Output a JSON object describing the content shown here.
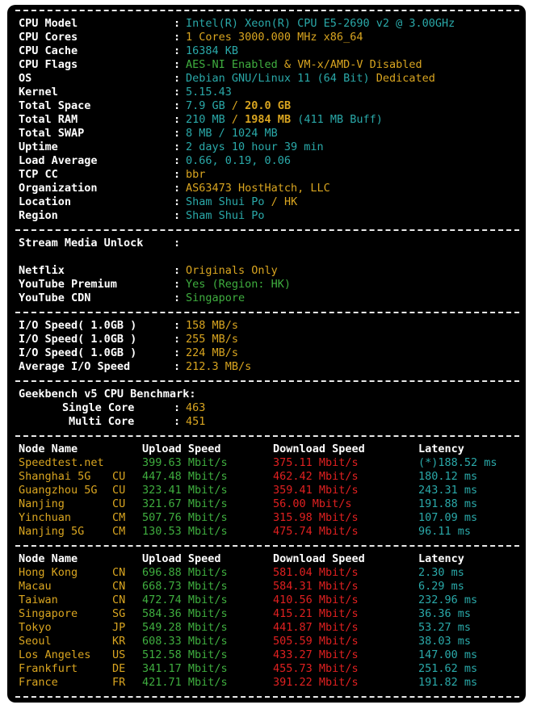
{
  "sysinfo": [
    {
      "label": "CPU Model",
      "value": "Intel(R) Xeon(R) CPU E5-2690 v2 @ 3.00GHz"
    },
    {
      "label": "CPU Cores",
      "value": "1 Cores 3000.000 MHz x86_64"
    },
    {
      "label": "CPU Cache",
      "value": "16384 KB"
    },
    {
      "label": "CPU Flags",
      "value_a": "AES-NI Enabled",
      "amp": " & ",
      "value_b": "VM-x/AMD-V Disabled"
    },
    {
      "label": "OS",
      "value_a": "Debian GNU/Linux 11 (64 Bit)",
      "value_b": " Dedicated"
    },
    {
      "label": "Kernel",
      "value": "5.15.43"
    },
    {
      "label": "Total Space",
      "value_a": "7.9 GB",
      "slash": " / ",
      "value_b": "20.0 GB"
    },
    {
      "label": "Total RAM",
      "value_a": "210 MB",
      "slash": " / ",
      "value_b": "1984 MB",
      "value_c": " (411 MB Buff)"
    },
    {
      "label": "Total SWAP",
      "value": "8 MB / 1024 MB"
    },
    {
      "label": "Uptime",
      "value": "2 days 10 hour 39 min"
    },
    {
      "label": "Load Average",
      "value": "0.66, 0.19, 0.06"
    },
    {
      "label": "TCP CC",
      "value": "bbr"
    },
    {
      "label": "Organization",
      "value": "AS63473 HostHatch, LLC"
    },
    {
      "label": "Location",
      "value_a": "Sham Shui Po",
      "slash": " / ",
      "value_b": "HK"
    },
    {
      "label": "Region",
      "value": "Sham Shui Po"
    }
  ],
  "stream": {
    "title": "Stream Media Unlock",
    "colon": ":",
    "items": [
      {
        "label": "Netflix",
        "value": "Originals Only"
      },
      {
        "label": "YouTube Premium",
        "value": "Yes (Region: HK)"
      },
      {
        "label": "YouTube CDN",
        "value": "Singapore"
      }
    ]
  },
  "io": [
    {
      "label": "I/O Speed( 1.0GB )",
      "value": "158 MB/s"
    },
    {
      "label": "I/O Speed( 1.0GB )",
      "value": "255 MB/s"
    },
    {
      "label": "I/O Speed( 1.0GB )",
      "value": "224 MB/s"
    },
    {
      "label": "Average I/O Speed",
      "value": "212.3 MB/s"
    }
  ],
  "geekbench": {
    "title": "Geekbench v5 CPU Benchmark:",
    "single_label": "Single Core",
    "single_value": "463",
    "multi_label": "Multi Core",
    "multi_value": "451"
  },
  "colon": ":",
  "speed_headers": {
    "node": "Node Name",
    "upload": "Upload Speed",
    "download": "Download Speed",
    "latency": "Latency"
  },
  "speed1": [
    {
      "node": "Speedtest.net",
      "isp": "",
      "up": "399.63 Mbit/s",
      "down": "375.11 Mbit/s",
      "lat": "(*)188.52 ms"
    },
    {
      "node": "Shanghai 5G",
      "isp": "CU",
      "up": "447.48 Mbit/s",
      "down": "462.42 Mbit/s",
      "lat": "180.12 ms"
    },
    {
      "node": "Guangzhou 5G",
      "isp": "CU",
      "up": "323.41 Mbit/s",
      "down": "359.41 Mbit/s",
      "lat": "243.31 ms"
    },
    {
      "node": "Nanjing",
      "isp": "CU",
      "up": "321.67 Mbit/s",
      "down": "56.00 Mbit/s",
      "lat": "191.88 ms"
    },
    {
      "node": "Yinchuan",
      "isp": "CM",
      "up": "507.76 Mbit/s",
      "down": "315.98 Mbit/s",
      "lat": "107.09 ms"
    },
    {
      "node": "Nanjing 5G",
      "isp": "CM",
      "up": "130.53 Mbit/s",
      "down": "475.74 Mbit/s",
      "lat": "96.11 ms"
    }
  ],
  "speed2": [
    {
      "node": "Hong Kong",
      "isp": "CN",
      "up": "696.88 Mbit/s",
      "down": "581.04 Mbit/s",
      "lat": "2.30 ms"
    },
    {
      "node": "Macau",
      "isp": "CN",
      "up": "668.73 Mbit/s",
      "down": "584.31 Mbit/s",
      "lat": "6.29 ms"
    },
    {
      "node": "Taiwan",
      "isp": "CN",
      "up": "472.74 Mbit/s",
      "down": "410.56 Mbit/s",
      "lat": "232.96 ms"
    },
    {
      "node": "Singapore",
      "isp": "SG",
      "up": "584.36 Mbit/s",
      "down": "415.21 Mbit/s",
      "lat": "36.36 ms"
    },
    {
      "node": "Tokyo",
      "isp": "JP",
      "up": "549.28 Mbit/s",
      "down": "441.87 Mbit/s",
      "lat": "53.27 ms"
    },
    {
      "node": "Seoul",
      "isp": "KR",
      "up": "608.33 Mbit/s",
      "down": "505.59 Mbit/s",
      "lat": "38.03 ms"
    },
    {
      "node": "Los Angeles",
      "isp": "US",
      "up": "512.58 Mbit/s",
      "down": "433.27 Mbit/s",
      "lat": "147.00 ms"
    },
    {
      "node": "Frankfurt",
      "isp": "DE",
      "up": "341.17 Mbit/s",
      "down": "455.73 Mbit/s",
      "lat": "251.62 ms"
    },
    {
      "node": "France",
      "isp": "FR",
      "up": "421.71 Mbit/s",
      "down": "391.22 Mbit/s",
      "lat": "191.82 ms"
    }
  ]
}
